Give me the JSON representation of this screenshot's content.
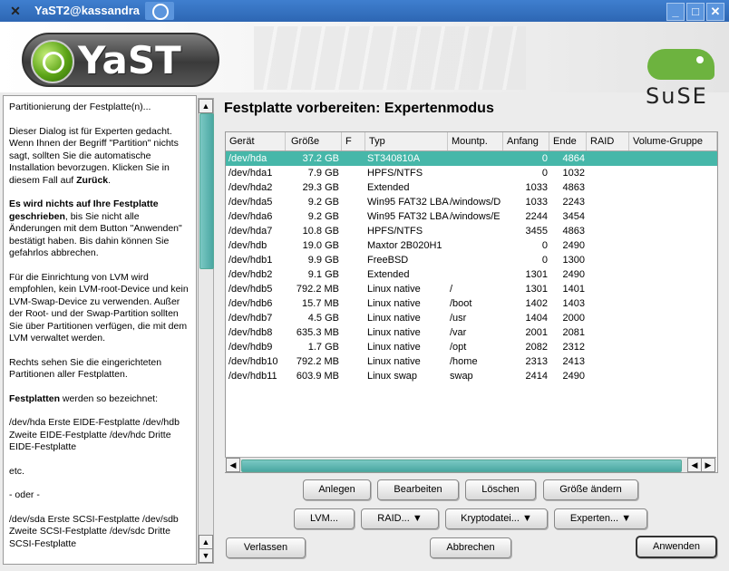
{
  "window": {
    "title": "YaST2@kassandra"
  },
  "header": {
    "logo_text": "YaST",
    "brand_text": "SuSE"
  },
  "help": {
    "p1": "Partitionierung der Festplatte(n)...",
    "p2": "Dieser Dialog ist für Experten gedacht. Wenn Ihnen der Begriff \"Partition\" nichts sagt, sollten Sie die automatische Installation bevorzugen. Klicken Sie in diesem Fall auf ",
    "p2_bold": "Zurück",
    "p2_end": ".",
    "p3_bold": "Es wird nichts auf Ihre Festplatte geschrieben",
    "p3": ", bis Sie nicht alle Änderungen mit dem Button \"Anwenden\" bestätigt haben. Bis dahin können Sie gefahrlos abbrechen.",
    "p4": "Für die Einrichtung von LVM wird empfohlen, kein LVM-root-Device und kein LVM-Swap-Device zu verwenden. Außer der Root- und der Swap-Partition sollten Sie über Partitionen verfügen, die mit dem LVM verwaltet werden.",
    "p5": "Rechts sehen Sie die eingerichteten Partitionen aller Festplatten.",
    "p6_bold": "Festplatten",
    "p6": " werden so bezeichnet:",
    "p7": "/dev/hda Erste EIDE-Festplatte /dev/hdb Zweite EIDE-Festplatte /dev/hdc Dritte EIDE-Festplatte",
    "p8": "etc.",
    "p9": "- oder -",
    "p10": "/dev/sda Erste SCSI-Festplatte /dev/sdb Zweite SCSI-Festplatte /dev/sdc Dritte SCSI-Festplatte"
  },
  "main": {
    "title": "Festplatte vorbereiten: Expertenmodus"
  },
  "table": {
    "columns": [
      "Gerät",
      "Größe",
      "F",
      "Typ",
      "Mountp.",
      "Anfang",
      "Ende",
      "RAID",
      "Volume-Gruppe"
    ],
    "rows": [
      [
        "/dev/hda",
        "37.2 GB",
        "",
        "ST340810A",
        "",
        "0",
        "4864",
        "",
        ""
      ],
      [
        "/dev/hda1",
        "7.9 GB",
        "",
        "HPFS/NTFS",
        "",
        "0",
        "1032",
        "",
        ""
      ],
      [
        "/dev/hda2",
        "29.3 GB",
        "",
        "Extended",
        "",
        "1033",
        "4863",
        "",
        ""
      ],
      [
        "/dev/hda5",
        "9.2 GB",
        "",
        "Win95 FAT32 LBA",
        "/windows/D",
        "1033",
        "2243",
        "",
        ""
      ],
      [
        "/dev/hda6",
        "9.2 GB",
        "",
        "Win95 FAT32 LBA",
        "/windows/E",
        "2244",
        "3454",
        "",
        ""
      ],
      [
        "/dev/hda7",
        "10.8 GB",
        "",
        "HPFS/NTFS",
        "",
        "3455",
        "4863",
        "",
        ""
      ],
      [
        "/dev/hdb",
        "19.0 GB",
        "",
        "Maxtor 2B020H1",
        "",
        "0",
        "2490",
        "",
        ""
      ],
      [
        "/dev/hdb1",
        "9.9 GB",
        "",
        "FreeBSD",
        "",
        "0",
        "1300",
        "",
        ""
      ],
      [
        "/dev/hdb2",
        "9.1 GB",
        "",
        "Extended",
        "",
        "1301",
        "2490",
        "",
        ""
      ],
      [
        "/dev/hdb5",
        "792.2 MB",
        "",
        "Linux native",
        "/",
        "1301",
        "1401",
        "",
        ""
      ],
      [
        "/dev/hdb6",
        "15.7 MB",
        "",
        "Linux native",
        "/boot",
        "1402",
        "1403",
        "",
        ""
      ],
      [
        "/dev/hdb7",
        "4.5 GB",
        "",
        "Linux native",
        "/usr",
        "1404",
        "2000",
        "",
        ""
      ],
      [
        "/dev/hdb8",
        "635.3 MB",
        "",
        "Linux native",
        "/var",
        "2001",
        "2081",
        "",
        ""
      ],
      [
        "/dev/hdb9",
        "1.7 GB",
        "",
        "Linux native",
        "/opt",
        "2082",
        "2312",
        "",
        ""
      ],
      [
        "/dev/hdb10",
        "792.2 MB",
        "",
        "Linux native",
        "/home",
        "2313",
        "2413",
        "",
        ""
      ],
      [
        "/dev/hdb11",
        "603.9 MB",
        "",
        "Linux swap",
        "swap",
        "2414",
        "2490",
        "",
        ""
      ]
    ],
    "selected_row": 0
  },
  "buttons": {
    "anlegen": "Anlegen",
    "bearbeiten": "Bearbeiten",
    "loeschen": "Löschen",
    "groesse": "Größe ändern",
    "lvm": "LVM...",
    "raid": "RAID...",
    "krypto": "Kryptodatei...",
    "experten": "Experten...",
    "verlassen": "Verlassen",
    "abbrechen": "Abbrechen",
    "anwenden": "Anwenden"
  },
  "colors": {
    "selection": "#46b7a9",
    "titlebar": "#2d66b3"
  }
}
